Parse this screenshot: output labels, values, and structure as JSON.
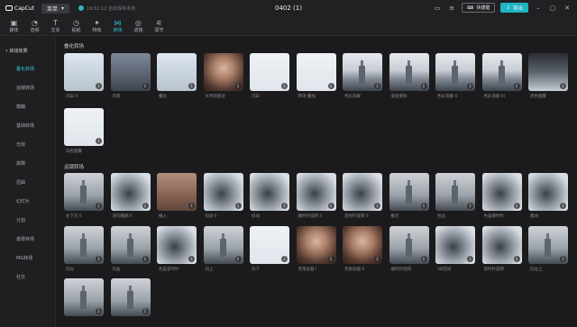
{
  "titlebar": {
    "app_name": "CapCut",
    "menu_label": "菜单",
    "save_status": "19:51:12 自动保存本地",
    "project_title": "0402 (1)",
    "shortcut_label": "快捷键",
    "export_label": "导出"
  },
  "toolbar": {
    "tabs": [
      {
        "label": "媒体",
        "icon": "media-icon"
      },
      {
        "label": "音频",
        "icon": "audio-icon"
      },
      {
        "label": "文本",
        "icon": "text-icon"
      },
      {
        "label": "贴纸",
        "icon": "sticker-icon"
      },
      {
        "label": "特效",
        "icon": "effects-icon"
      },
      {
        "label": "转场",
        "icon": "transition-icon"
      },
      {
        "label": "滤镜",
        "icon": "filter-icon"
      },
      {
        "label": "调节",
        "icon": "adjust-icon"
      }
    ],
    "active_tab": "转场"
  },
  "sidebar": {
    "group_label": "• 转场效果",
    "items": [
      "叠化转场",
      "运镜转场",
      "模糊",
      "基础转场",
      "光效",
      "故障",
      "扭曲",
      "幻灯片",
      "分割",
      "遮罩转场",
      "MG转场",
      "社交"
    ],
    "active_item": "叠化转场"
  },
  "sections": [
    {
      "title": "叠化转场",
      "items": [
        "闪白 II",
        "闪黑",
        "叠化",
        "岁月的痕迹",
        "闪白",
        "转场-叠加",
        "色彩溶解",
        "渐变擦除",
        "色彩溶解 II",
        "色彩溶解 III",
        "黑色烟雾",
        "白色烟雾"
      ]
    },
    {
      "title": "运镜转场",
      "items": [
        "左下方 II",
        "逆向模糊 II",
        "推入",
        "抖动 II",
        "抖动",
        "顺时针旋转 II",
        "逆时针旋转 II",
        "推近",
        "拉远",
        "色差顺时针",
        "震动",
        "向左",
        "向右",
        "色差逆时针",
        "向上",
        "向下",
        "无限穿越 I",
        "无限穿越 II",
        "顺时针旋转",
        "3D空间",
        "逆时针旋转",
        "向左上",
        "",
        ""
      ]
    }
  ],
  "colors": {
    "accent": "#2cc6d6",
    "export_button": "#1fb5c3",
    "background": "#1b1b1d"
  }
}
